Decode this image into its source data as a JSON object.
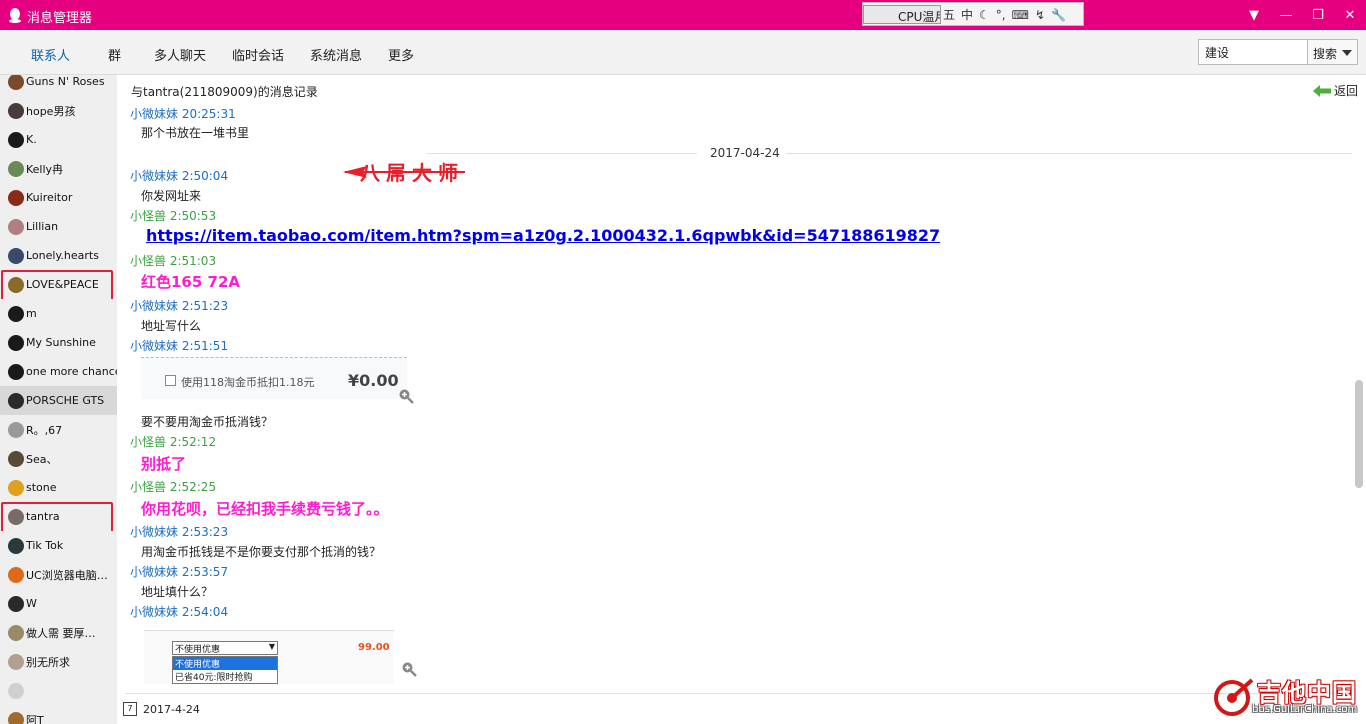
{
  "window": {
    "title": "消息管理器",
    "ime": {
      "cpu_label": "CPU温月"
    }
  },
  "tabs": [
    {
      "label": "联系人",
      "active": true
    },
    {
      "label": "群"
    },
    {
      "label": "多人聊天"
    },
    {
      "label": "临时会话"
    },
    {
      "label": "系统消息"
    },
    {
      "label": "更多"
    }
  ],
  "search": {
    "value": "建设",
    "button_label": "搜索"
  },
  "contacts": [
    {
      "name": "Guns N' Roses",
      "avatar_color": "#7a4a2a"
    },
    {
      "name": "hope男孩",
      "avatar_color": "#4a3a3a"
    },
    {
      "name": "K.",
      "avatar_color": "#1a1a1a"
    },
    {
      "name": "Kelly冉",
      "avatar_color": "#6a8a5a"
    },
    {
      "name": "Kuireitor",
      "avatar_color": "#8a2a1a"
    },
    {
      "name": "Lillian",
      "avatar_color": "#b08080"
    },
    {
      "name": "Lonely.hearts",
      "avatar_color": "#3a4a6a"
    },
    {
      "name": "LOVE&PEACE",
      "avatar_color": "#8a6a2a",
      "boxed": true
    },
    {
      "name": "m",
      "avatar_color": "#1a1a1a"
    },
    {
      "name": "My  Sunshine",
      "avatar_color": "#1a1a1a"
    },
    {
      "name": "one more chance",
      "avatar_color": "#1a1a1a"
    },
    {
      "name": "PORSCHE GTS",
      "avatar_color": "#2a2a2a",
      "selected": true
    },
    {
      "name": "R。,67",
      "avatar_color": "#9a9a9a"
    },
    {
      "name": "Sea、",
      "avatar_color": "#5a4a3a"
    },
    {
      "name": "stone",
      "avatar_color": "#e0a020"
    },
    {
      "name": "tantra",
      "avatar_color": "#7a6a6a",
      "boxed": true
    },
    {
      "name": "Tik Tok",
      "avatar_color": "#2a3a3a"
    },
    {
      "name": "UC浏览器电脑…",
      "avatar_color": "#e06a1a"
    },
    {
      "name": "W",
      "avatar_color": "#2a2a2a"
    },
    {
      "name": "做人需   要厚…",
      "avatar_color": "#9a8a6a"
    },
    {
      "name": "别无所求",
      "avatar_color": "#b0a090"
    },
    {
      "name": "",
      "avatar_color": "#cfcfcf"
    },
    {
      "name": "阿T",
      "avatar_color": "#a06a2a"
    }
  ],
  "content": {
    "header_title": "与tantra(211809009)的消息记录",
    "back_label": "返回",
    "date_separator": "2017-04-24",
    "annotation": "八屌大师",
    "messages": [
      {
        "sender": "小微妹妹  20:25:31",
        "text": "那个书放在一堆书里"
      },
      {
        "sender": "小微妹妹  2:50:04",
        "text": "你发网址来"
      },
      {
        "sender": "小怪兽  2:50:53",
        "link": "https://item.taobao.com/item.htm?spm=a1z0g.2.1000432.1.6qpwbk&id=547188619827"
      },
      {
        "sender": "小怪兽  2:51:03",
        "text": "红色165 72A"
      },
      {
        "sender": "小微妹妹  2:51:23",
        "text": "地址写什么"
      },
      {
        "sender": "小微妹妹  2:51:51",
        "image": {
          "checkbox_label": "使用118淘金币抵扣1.18元",
          "price": "¥0.00"
        },
        "text": "要不要用淘金币抵消钱？"
      },
      {
        "sender": "小怪兽  2:52:12",
        "text": "别抵了"
      },
      {
        "sender": "小怪兽  2:52:25",
        "text": "你用花呗，已经扣我手续费亏钱了。。"
      },
      {
        "sender": "小微妹妹  2:53:23",
        "text": "用淘金币抵钱是不是你要支付那个抵消的钱？"
      },
      {
        "sender": "小微妹妹  2:53:57",
        "text": "地址填什么？"
      },
      {
        "sender": "小微妹妹  2:54:04",
        "image": {
          "select_value": "不使用优惠",
          "options": [
            "不使用优惠",
            "已省40元:限时抢购"
          ],
          "price": "99.00"
        }
      }
    ],
    "footer_date": "2017-4-24",
    "footer_cal_day": "7"
  },
  "watermark": {
    "title": "吉他中国",
    "url": "bbs.GuitarChina.com"
  },
  "colors": {
    "titlebar": "#e4007f",
    "sender_blue": "#1c6fc0",
    "sender_green": "#3ea044",
    "pink_text": "#ff1cd0",
    "annotation_red": "#e81e2a"
  }
}
